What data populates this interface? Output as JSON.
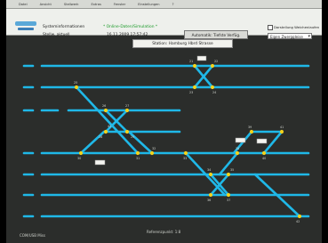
{
  "menu": {
    "items": [
      "Datei",
      "Ansicht",
      "Stellwerk",
      "Extras",
      "Fenster",
      "Einstellungen",
      "?"
    ]
  },
  "toolbar": {
    "system_title": "Systeminformationen",
    "system_subtitle": "Stellw. aktuell",
    "status_online": "* Online-Daten/Simulation *",
    "timestamp": "16.11.2009 17:57:42",
    "mode_button": "Automatik: Tiefste Verfüg.",
    "checkbox_label": "Darstellung Weichenlaufen",
    "select_value": "Eigen Zwerggleise"
  },
  "station": {
    "label": "Station: Hamburg Hbrd Strasse"
  },
  "status": {
    "left": "COM/USB Miss",
    "center": "Referenzpunkt: 1:8"
  },
  "tracks": {
    "signal_labels": [
      "21",
      "22",
      "23",
      "24",
      "25",
      "26",
      "27",
      "28",
      "29",
      "30",
      "31",
      "32",
      "33",
      "34",
      "35",
      "36",
      "37",
      "38",
      "39",
      "40",
      "41",
      "42",
      "43"
    ]
  },
  "colors": {
    "track": "#1fb8e8",
    "signal": "#f2d21c",
    "background": "#2b2d2b"
  }
}
